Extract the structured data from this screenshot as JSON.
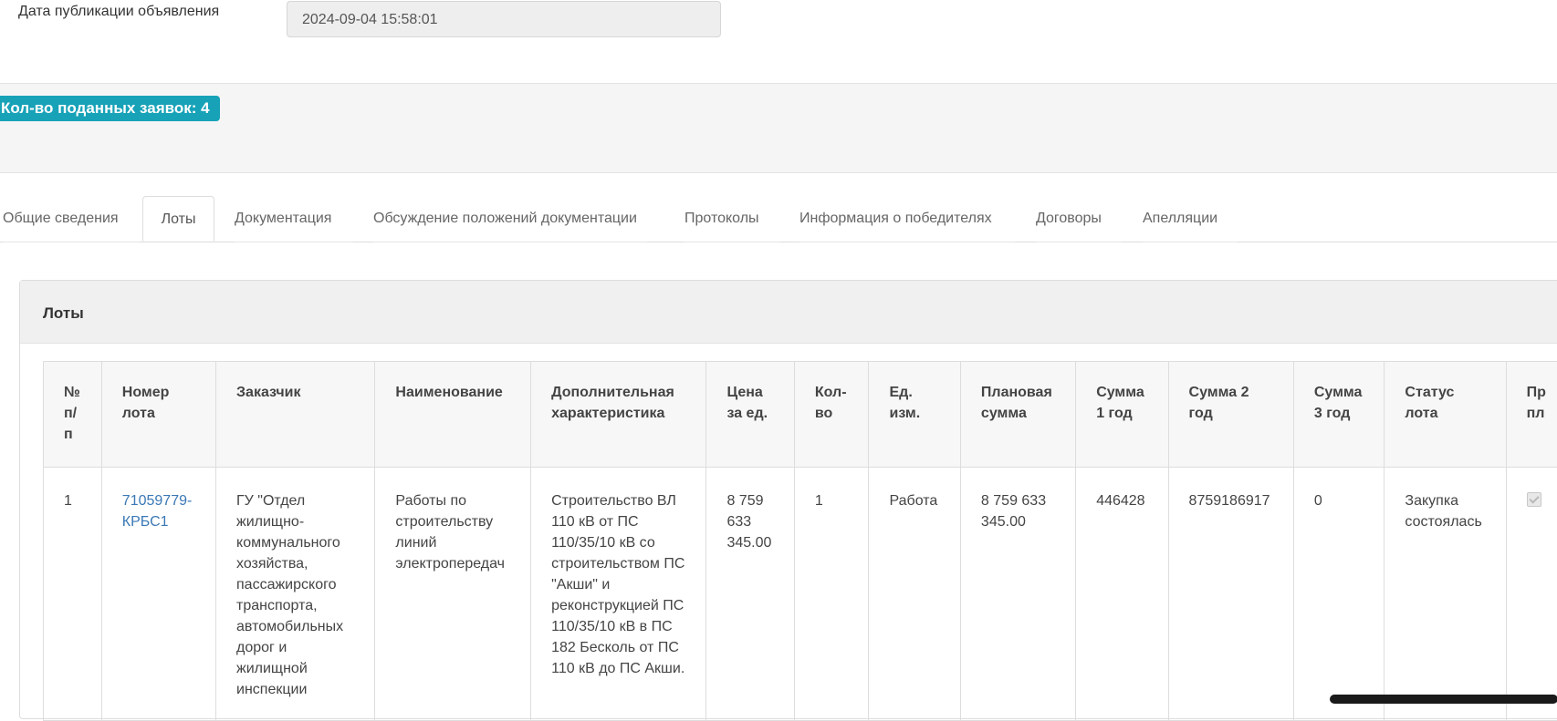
{
  "publication": {
    "label": "Дата публикации объявления",
    "value": "2024-09-04 15:58:01"
  },
  "badge": {
    "text": "Кол-во поданных заявок: 4",
    "color": "#17a2b8"
  },
  "tabs": [
    {
      "label": "Общие сведения",
      "active": false
    },
    {
      "label": "Лоты",
      "active": true
    },
    {
      "label": "Документация",
      "active": false
    },
    {
      "label": "Обсуждение положений документации",
      "active": false
    },
    {
      "label": "Протоколы",
      "active": false
    },
    {
      "label": "Информация о победителях",
      "active": false
    },
    {
      "label": "Договоры",
      "active": false
    },
    {
      "label": "Апелляции",
      "active": false
    }
  ],
  "panel": {
    "title": "Лоты"
  },
  "table": {
    "headers": [
      "№ п/п",
      "Номер лота",
      "Заказчик",
      "Наименование",
      "Дополнительная характеристика",
      "Цена за ед.",
      "Кол-во",
      "Ед. изм.",
      "Плановая сумма",
      "Сумма 1 год",
      "Сумма 2 год",
      "Сумма 3 год",
      "Статус лота",
      "Пр пл"
    ],
    "rows": [
      {
        "num": "1",
        "lot_number": "71059779-КРБС1",
        "customer": "ГУ \"Отдел жилищно-коммунального хозяйства, пассажирского транспорта, автомобильных дорог и жилищной инспекции",
        "name": "Работы по строительству линий электропередач",
        "extra": "Строительство ВЛ 110 кВ от ПС 110/35/10 кВ со строительством ПС \"Акши\" и реконструкцией ПС 110/35/10 кВ в ПС 182 Бесколь от ПС 110 кВ до ПС Акши.",
        "price": "8 759 633 345.00",
        "qty": "1",
        "unit": "Работа",
        "planned": "8 759 633 345.00",
        "sum1": "446428",
        "sum2": "8759186917",
        "sum3": "0",
        "status": "Закупка состоялась",
        "checked": true
      }
    ]
  }
}
